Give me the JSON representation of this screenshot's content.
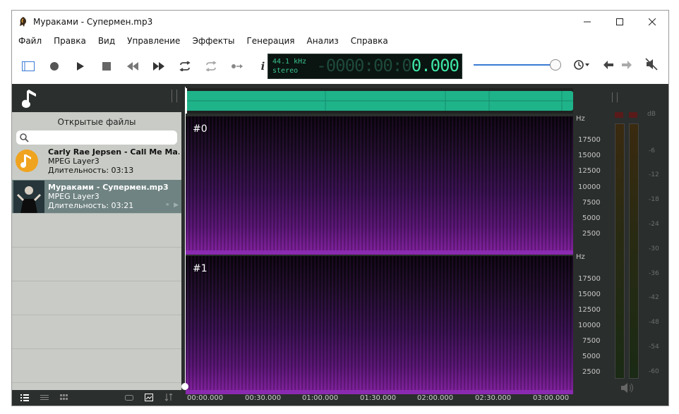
{
  "window": {
    "title": "Мураками - Супермен.mp3"
  },
  "menu": [
    "Файл",
    "Правка",
    "Вид",
    "Управление",
    "Эффекты",
    "Генерация",
    "Анализ",
    "Справка"
  ],
  "lcd": {
    "rate": "44.1 kHz",
    "channels": "stereo",
    "time_dim": "-0000:00:0",
    "time_bright": "0.000"
  },
  "sidebar": {
    "title": "Открытые файлы",
    "search_placeholder": "",
    "files": [
      {
        "name": "Carly Rae Jepsen - Call Me Ma...",
        "format": "MPEG Layer3",
        "duration": "Длительность: 03:13",
        "selected": false
      },
      {
        "name": "Мураками - Супермен.mp3",
        "format": "MPEG Layer3",
        "duration": "Длительность: 03:21",
        "selected": true
      }
    ]
  },
  "channels": [
    {
      "label": "#0"
    },
    {
      "label": "#1"
    }
  ],
  "freq_unit": "Hz",
  "freq_ticks": [
    "17500",
    "15000",
    "12500",
    "10000",
    "7500",
    "5000",
    "2500"
  ],
  "time_ticks": [
    "00:00.000",
    "00:30.000",
    "01:00.000",
    "01:30.000",
    "02:00.000",
    "02:30.000",
    "03:00.000"
  ],
  "meter": {
    "unit": "dB",
    "ticks": [
      "-6",
      "-12",
      "-18",
      "-24",
      "-30",
      "-36",
      "-42",
      "-48",
      "-54",
      "-60"
    ]
  },
  "colors": {
    "accent": "#3a7bd5",
    "waveform": "#1fb38a",
    "spectrogram": "#7a1e9e",
    "lcd_text": "#3ee6a6"
  }
}
